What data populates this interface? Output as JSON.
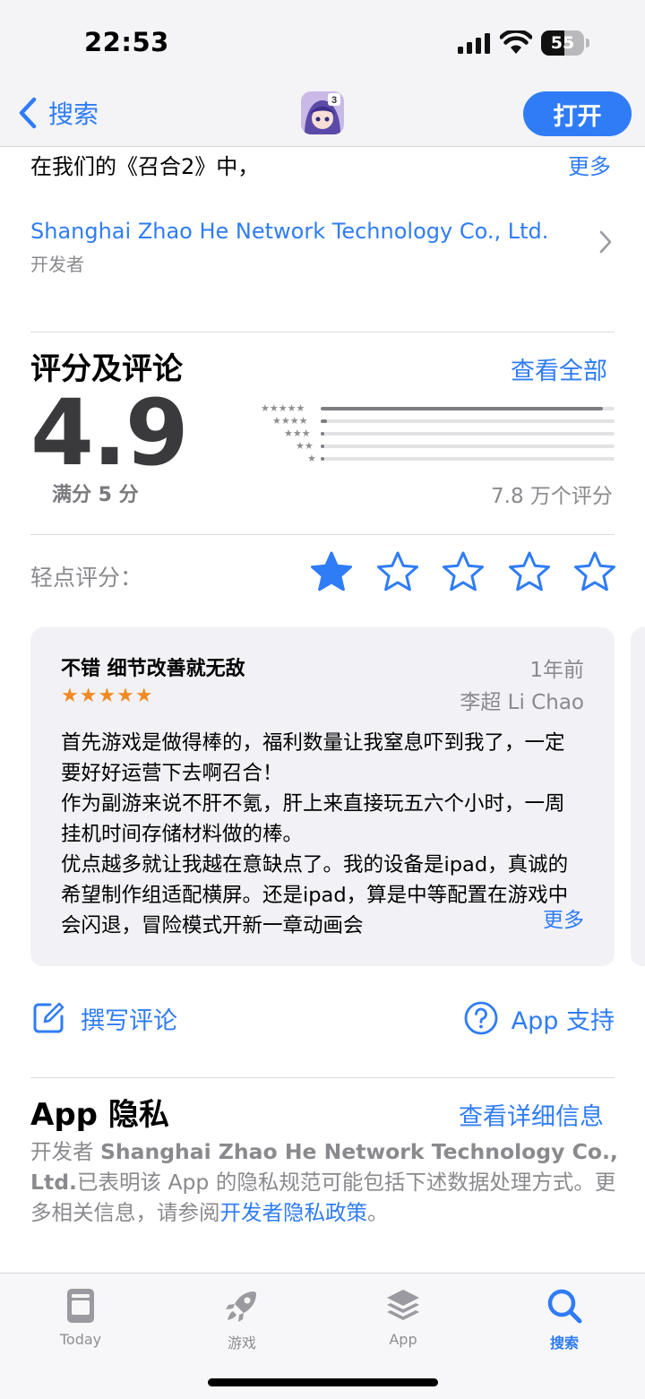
{
  "status_bar": {
    "time": "22:53",
    "battery": "55",
    "battery_level": 0.55
  },
  "nav": {
    "back_label": "搜索",
    "open_label": "打开"
  },
  "description": {
    "text": "在我们的《召合2》中，",
    "more": "更多"
  },
  "developer": {
    "name": "Shanghai Zhao He Network Technology Co., Ltd.",
    "label": "开发者"
  },
  "ratings": {
    "title": "评分及评论",
    "see_all": "查看全部",
    "score": "4.9",
    "out_of": "满分 5 分",
    "count": "7.8 万个评分",
    "histogram": [
      {
        "stars": "★★★★★",
        "fraction": 0.96
      },
      {
        "stars": "★★★★",
        "fraction": 0.02
      },
      {
        "stars": "★★★",
        "fraction": 0.01
      },
      {
        "stars": "★★",
        "fraction": 0.01
      },
      {
        "stars": "★",
        "fraction": 0.01
      }
    ],
    "tap_label": "轻点评分：",
    "tap_rating_selected": 1
  },
  "review": {
    "title": "不错 细节改善就无敌",
    "date": "1年前",
    "stars": "★★★★★",
    "rating": 5,
    "author": "李超 Li Chao",
    "body": "首先游戏是做得棒的，福利数量让我窒息吓到我了，一定要好好运营下去啊召合！\n作为副游来说不肝不氪，肝上来直接玩五六个小时，一周挂机时间存储材料做的棒。\n优点越多就让我越在意缺点了。我的设备是ipad，真诚的希望制作组适配横屏。还是ipad，算是中等配置在游戏中会闪退，冒险模式开新一章动画会",
    "more": "更多"
  },
  "actions": {
    "write_review": "撰写评论",
    "support": "App 支持"
  },
  "privacy": {
    "title": "App 隐私",
    "link": "查看详细信息",
    "prefix": "开发者 ",
    "developer": "Shanghai Zhao He Network Technology Co., Ltd.",
    "middle": "已表明该 App 的隐私规范可能包括下述数据处理方式。更多相关信息，请参阅",
    "policy_link": "开发者隐私政策",
    "suffix": "。"
  },
  "tabs": [
    {
      "label": "Today",
      "icon": "today-icon"
    },
    {
      "label": "游戏",
      "icon": "rocket-icon"
    },
    {
      "label": "App",
      "icon": "layers-icon"
    },
    {
      "label": "搜索",
      "icon": "search-icon",
      "active": true
    }
  ],
  "colors": {
    "accent": "#2f7cf6",
    "review_star": "#f08a24",
    "secondary_text": "#8a8a8e"
  }
}
